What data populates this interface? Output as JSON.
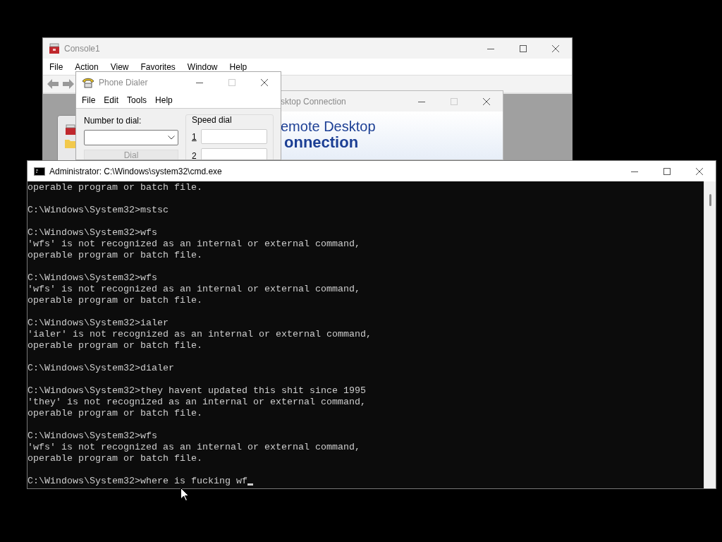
{
  "console_window": {
    "title": "Console1",
    "menu": [
      "File",
      "Action",
      "View",
      "Favorites",
      "Window",
      "Help"
    ]
  },
  "rdc_window": {
    "title": "sktop Connection",
    "banner_line_1": "emote Desktop",
    "banner_line_2": "onnection"
  },
  "dialer_window": {
    "title": "Phone Dialer",
    "menu": [
      "File",
      "Edit",
      "Tools",
      "Help"
    ],
    "number_label": "Number to dial:",
    "dial_button": "Dial",
    "speed_dial_label": "Speed dial",
    "speed_dial": [
      "1",
      "2"
    ]
  },
  "cmd_window": {
    "title": "Administrator: C:\\Windows\\system32\\cmd.exe",
    "cursor": true,
    "blocks": [
      [
        "operable program or batch file."
      ],
      [
        "C:\\Windows\\System32>mstsc"
      ],
      [
        "C:\\Windows\\System32>wfs",
        "'wfs' is not recognized as an internal or external command,",
        "operable program or batch file."
      ],
      [
        "C:\\Windows\\System32>wfs",
        "'wfs' is not recognized as an internal or external command,",
        "operable program or batch file."
      ],
      [
        "C:\\Windows\\System32>ialer",
        "'ialer' is not recognized as an internal or external command,",
        "operable program or batch file."
      ],
      [
        "C:\\Windows\\System32>dialer"
      ],
      [
        "C:\\Windows\\System32>they havent updated this shit since 1995",
        "'they' is not recognized as an internal or external command,",
        "operable program or batch file."
      ],
      [
        "C:\\Windows\\System32>wfs",
        "'wfs' is not recognized as an internal or external command,",
        "operable program or batch file."
      ],
      [
        "C:\\Windows\\System32>where is fucking wf"
      ]
    ]
  }
}
